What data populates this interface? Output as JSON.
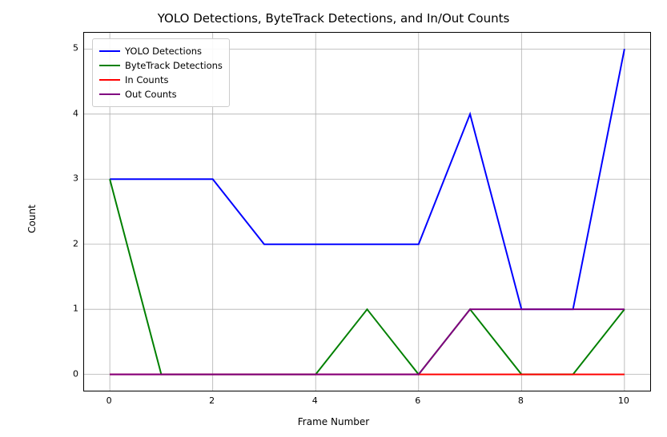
{
  "chart_data": {
    "type": "line",
    "title": "YOLO Detections, ByteTrack Detections, and In/Out Counts",
    "xlabel": "Frame Number",
    "ylabel": "Count",
    "x": [
      0,
      1,
      2,
      3,
      4,
      5,
      6,
      7,
      8,
      9,
      10
    ],
    "xlim": [
      -0.5,
      10.5
    ],
    "ylim": [
      -0.25,
      5.25
    ],
    "x_ticks": [
      0,
      2,
      4,
      6,
      8,
      10
    ],
    "y_ticks": [
      0,
      1,
      2,
      3,
      4,
      5
    ],
    "grid": true,
    "legend_position": "upper left",
    "series": [
      {
        "name": "YOLO Detections",
        "color": "#0000ff",
        "values": [
          3,
          3,
          3,
          2,
          2,
          2,
          2,
          4,
          1,
          1,
          5
        ]
      },
      {
        "name": "ByteTrack Detections",
        "color": "#008000",
        "values": [
          3,
          0,
          0,
          0,
          0,
          1,
          0,
          1,
          0,
          0,
          1
        ]
      },
      {
        "name": "In Counts",
        "color": "#ff0000",
        "values": [
          0,
          0,
          0,
          0,
          0,
          0,
          0,
          0,
          0,
          0,
          0
        ]
      },
      {
        "name": "Out Counts",
        "color": "#800080",
        "values": [
          0,
          0,
          0,
          0,
          0,
          0,
          0,
          1,
          1,
          1,
          1
        ]
      }
    ]
  }
}
